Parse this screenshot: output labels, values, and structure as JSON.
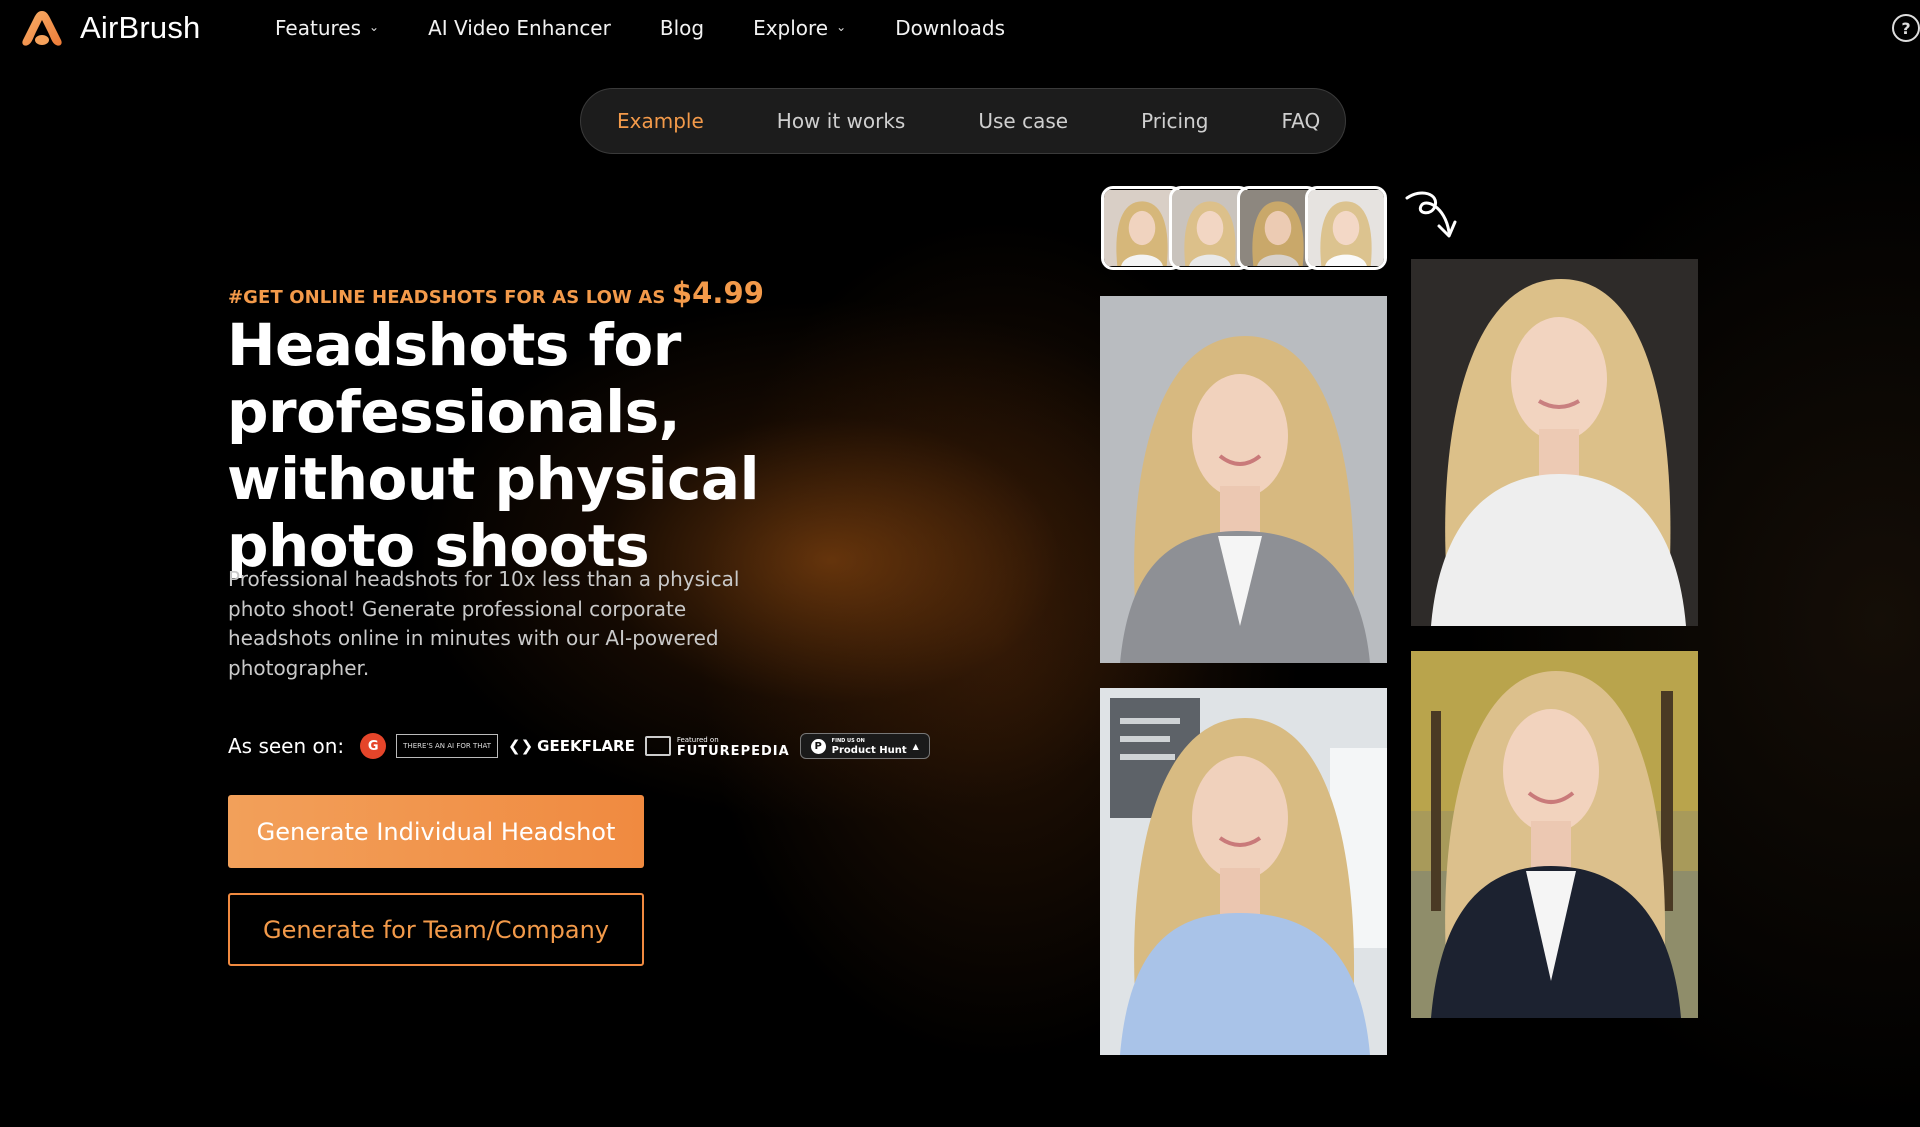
{
  "brand": {
    "name": "AirBrush",
    "accent": "#f39a4a"
  },
  "topnav": {
    "items": [
      {
        "label": "Features",
        "dropdown": true
      },
      {
        "label": "AI Video Enhancer",
        "dropdown": false
      },
      {
        "label": "Blog",
        "dropdown": false
      },
      {
        "label": "Explore",
        "dropdown": true
      },
      {
        "label": "Downloads",
        "dropdown": false
      }
    ],
    "help_icon": "question-circle-icon"
  },
  "section_nav": {
    "items": [
      "Example",
      "How it works",
      "Use case",
      "Pricing",
      "FAQ"
    ],
    "active": "Example"
  },
  "hero": {
    "promo_text": "#GET ONLINE HEADSHOTS FOR AS LOW AS",
    "promo_price": "$4.99",
    "headline": "Headshots for professionals, without physical photo shoots",
    "description": "Professional headshots for 10x less than a physical photo shoot! Generate professional corporate headshots online in minutes with our AI-powered photographer.",
    "seen_on_label": "As seen on:",
    "press": {
      "g2": "G",
      "aiforthat": "THERE'S AN AI FOR THAT",
      "geekflare": "GEEKFLARE",
      "futurepedia_small": "Featured on",
      "futurepedia": "FUTUREPEDIA",
      "producthunt_small": "FIND US ON",
      "producthunt": "Product Hunt"
    },
    "primary_button": "Generate Individual Headshot",
    "secondary_button": "Generate for Team/Company"
  },
  "gallery": {
    "thumbnail_count": 4,
    "photos": [
      {
        "name": "headshot-gray-blazer",
        "bg": "#b9bcc0",
        "outfit": "#8e9095"
      },
      {
        "name": "headshot-white-shirt",
        "bg": "#2e2b29",
        "outfit": "#eeeeee"
      },
      {
        "name": "headshot-blue-shirt-office",
        "bg": "#dfe3e6",
        "outfit": "#a9c3e8"
      },
      {
        "name": "headshot-black-blazer-park",
        "bg": "#9a8a4a",
        "outfit": "#1c2230"
      }
    ]
  }
}
